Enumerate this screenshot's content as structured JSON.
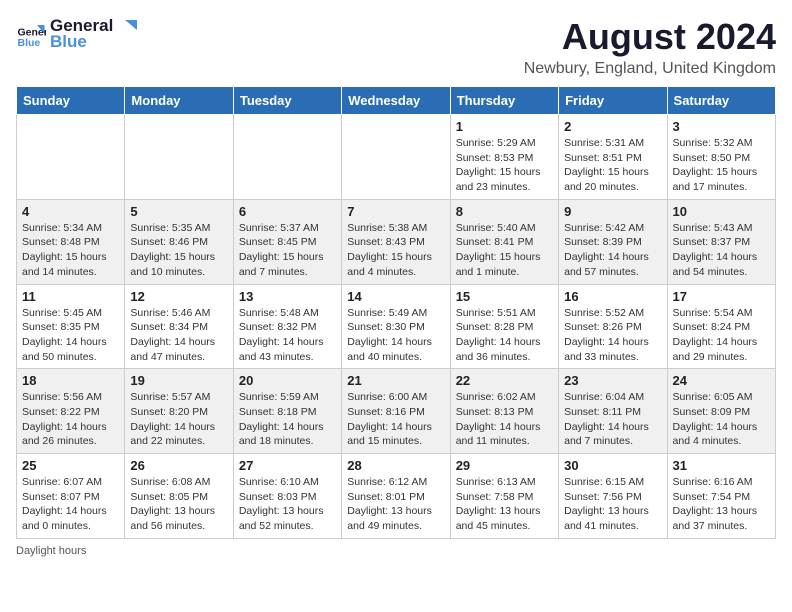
{
  "header": {
    "logo_line1": "General",
    "logo_line2": "Blue",
    "month": "August 2024",
    "location": "Newbury, England, United Kingdom"
  },
  "days_of_week": [
    "Sunday",
    "Monday",
    "Tuesday",
    "Wednesday",
    "Thursday",
    "Friday",
    "Saturday"
  ],
  "weeks": [
    [
      {
        "day": "",
        "info": ""
      },
      {
        "day": "",
        "info": ""
      },
      {
        "day": "",
        "info": ""
      },
      {
        "day": "",
        "info": ""
      },
      {
        "day": "1",
        "info": "Sunrise: 5:29 AM\nSunset: 8:53 PM\nDaylight: 15 hours and 23 minutes."
      },
      {
        "day": "2",
        "info": "Sunrise: 5:31 AM\nSunset: 8:51 PM\nDaylight: 15 hours and 20 minutes."
      },
      {
        "day": "3",
        "info": "Sunrise: 5:32 AM\nSunset: 8:50 PM\nDaylight: 15 hours and 17 minutes."
      }
    ],
    [
      {
        "day": "4",
        "info": "Sunrise: 5:34 AM\nSunset: 8:48 PM\nDaylight: 15 hours and 14 minutes."
      },
      {
        "day": "5",
        "info": "Sunrise: 5:35 AM\nSunset: 8:46 PM\nDaylight: 15 hours and 10 minutes."
      },
      {
        "day": "6",
        "info": "Sunrise: 5:37 AM\nSunset: 8:45 PM\nDaylight: 15 hours and 7 minutes."
      },
      {
        "day": "7",
        "info": "Sunrise: 5:38 AM\nSunset: 8:43 PM\nDaylight: 15 hours and 4 minutes."
      },
      {
        "day": "8",
        "info": "Sunrise: 5:40 AM\nSunset: 8:41 PM\nDaylight: 15 hours and 1 minute."
      },
      {
        "day": "9",
        "info": "Sunrise: 5:42 AM\nSunset: 8:39 PM\nDaylight: 14 hours and 57 minutes."
      },
      {
        "day": "10",
        "info": "Sunrise: 5:43 AM\nSunset: 8:37 PM\nDaylight: 14 hours and 54 minutes."
      }
    ],
    [
      {
        "day": "11",
        "info": "Sunrise: 5:45 AM\nSunset: 8:35 PM\nDaylight: 14 hours and 50 minutes."
      },
      {
        "day": "12",
        "info": "Sunrise: 5:46 AM\nSunset: 8:34 PM\nDaylight: 14 hours and 47 minutes."
      },
      {
        "day": "13",
        "info": "Sunrise: 5:48 AM\nSunset: 8:32 PM\nDaylight: 14 hours and 43 minutes."
      },
      {
        "day": "14",
        "info": "Sunrise: 5:49 AM\nSunset: 8:30 PM\nDaylight: 14 hours and 40 minutes."
      },
      {
        "day": "15",
        "info": "Sunrise: 5:51 AM\nSunset: 8:28 PM\nDaylight: 14 hours and 36 minutes."
      },
      {
        "day": "16",
        "info": "Sunrise: 5:52 AM\nSunset: 8:26 PM\nDaylight: 14 hours and 33 minutes."
      },
      {
        "day": "17",
        "info": "Sunrise: 5:54 AM\nSunset: 8:24 PM\nDaylight: 14 hours and 29 minutes."
      }
    ],
    [
      {
        "day": "18",
        "info": "Sunrise: 5:56 AM\nSunset: 8:22 PM\nDaylight: 14 hours and 26 minutes."
      },
      {
        "day": "19",
        "info": "Sunrise: 5:57 AM\nSunset: 8:20 PM\nDaylight: 14 hours and 22 minutes."
      },
      {
        "day": "20",
        "info": "Sunrise: 5:59 AM\nSunset: 8:18 PM\nDaylight: 14 hours and 18 minutes."
      },
      {
        "day": "21",
        "info": "Sunrise: 6:00 AM\nSunset: 8:16 PM\nDaylight: 14 hours and 15 minutes."
      },
      {
        "day": "22",
        "info": "Sunrise: 6:02 AM\nSunset: 8:13 PM\nDaylight: 14 hours and 11 minutes."
      },
      {
        "day": "23",
        "info": "Sunrise: 6:04 AM\nSunset: 8:11 PM\nDaylight: 14 hours and 7 minutes."
      },
      {
        "day": "24",
        "info": "Sunrise: 6:05 AM\nSunset: 8:09 PM\nDaylight: 14 hours and 4 minutes."
      }
    ],
    [
      {
        "day": "25",
        "info": "Sunrise: 6:07 AM\nSunset: 8:07 PM\nDaylight: 14 hours and 0 minutes."
      },
      {
        "day": "26",
        "info": "Sunrise: 6:08 AM\nSunset: 8:05 PM\nDaylight: 13 hours and 56 minutes."
      },
      {
        "day": "27",
        "info": "Sunrise: 6:10 AM\nSunset: 8:03 PM\nDaylight: 13 hours and 52 minutes."
      },
      {
        "day": "28",
        "info": "Sunrise: 6:12 AM\nSunset: 8:01 PM\nDaylight: 13 hours and 49 minutes."
      },
      {
        "day": "29",
        "info": "Sunrise: 6:13 AM\nSunset: 7:58 PM\nDaylight: 13 hours and 45 minutes."
      },
      {
        "day": "30",
        "info": "Sunrise: 6:15 AM\nSunset: 7:56 PM\nDaylight: 13 hours and 41 minutes."
      },
      {
        "day": "31",
        "info": "Sunrise: 6:16 AM\nSunset: 7:54 PM\nDaylight: 13 hours and 37 minutes."
      }
    ]
  ],
  "footer": {
    "note": "Daylight hours"
  }
}
